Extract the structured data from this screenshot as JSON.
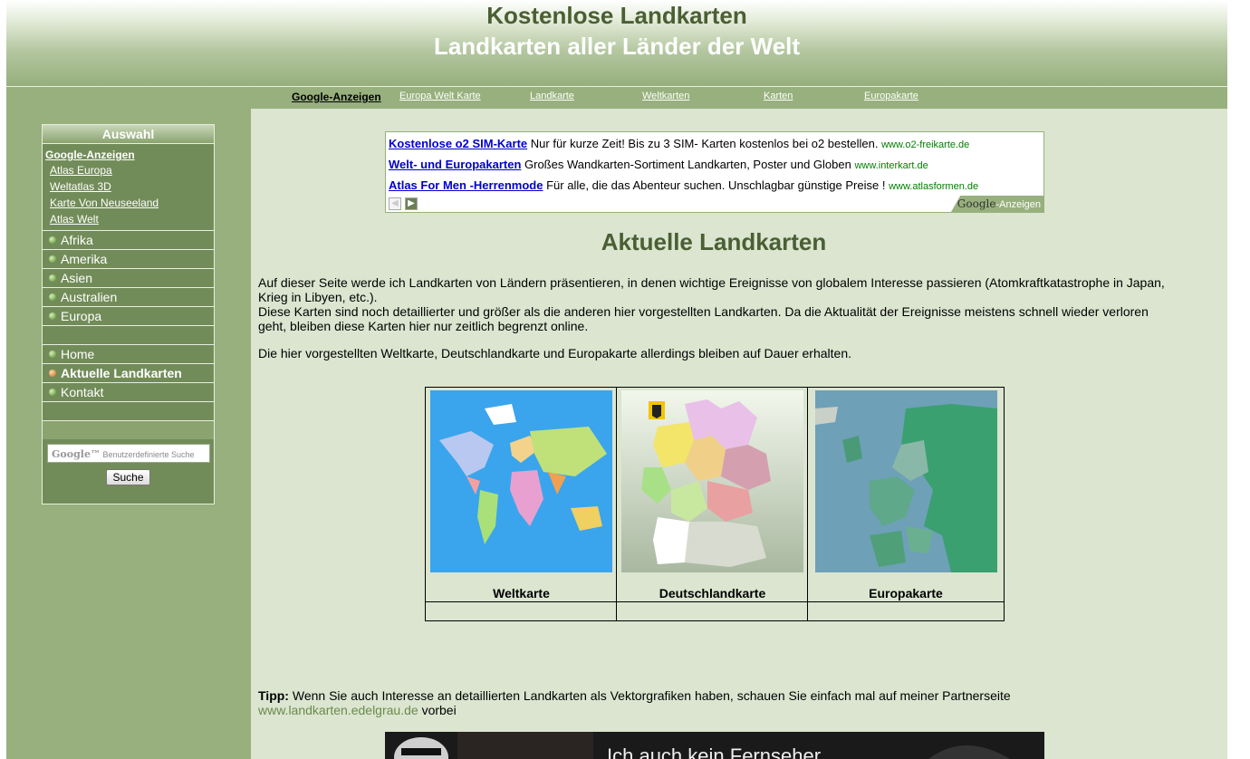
{
  "header": {
    "title_line1": "Kostenlose Landkarten",
    "title_line2": "Landkarten aller Länder der Welt"
  },
  "nav": {
    "items": [
      "Google-Anzeigen",
      "Europa Welt Karte",
      "Landkarte",
      "Weltkarten",
      "Karten",
      "Europakarte"
    ]
  },
  "sidebar": {
    "title": "Auswahl",
    "ads_heading": "Google-Anzeigen",
    "ad_links": [
      "Atlas Europa",
      "Weltatlas 3D",
      "Karte Von Neuseeland",
      "Atlas Welt"
    ],
    "regions": [
      "Afrika",
      "Amerika",
      "Asien",
      "Australien",
      "Europa"
    ],
    "pages": [
      "Home",
      "Aktuelle Landkarten",
      "Kontakt"
    ],
    "active_page": "Aktuelle Landkarten",
    "search_logo": "Google™",
    "search_placeholder": "Benutzerdefinierte Suche",
    "search_button": "Suche"
  },
  "adbox": {
    "ads": [
      {
        "headline": "Kostenlose o2 SIM-Karte",
        "text": "Nur für kurze Zeit! Bis zu 3 SIM- Karten kostenlos bei o2 bestellen.",
        "url": "www.o2-freikarte.de"
      },
      {
        "headline": "Welt- und Europakarten",
        "text": "Großes Wandkarten-Sortiment Landkarten, Poster und Globen",
        "url": "www.interkart.de"
      },
      {
        "headline": "Atlas For Men -Herrenmode",
        "text": "Für alle, die das Abenteur suchen. Unschlagbar günstige Preise !",
        "url": "www.atlasformen.de"
      }
    ],
    "badge_logo": "Google",
    "badge_text": "-Anzeigen"
  },
  "main": {
    "heading": "Aktuelle Landkarten",
    "para1": "Auf dieser Seite werde ich Landkarten von Ländern präsentieren, in denen wichtige Ereignisse von globalem Interesse passieren (Atomkraftkatastrophe in Japan, Krieg in Libyen, etc.).",
    "para2": "Diese Karten sind noch detaillierter und größer als die anderen hier vorgestellten Landkarten. Da die Aktualität der Ereignisse meistens schnell wieder verloren geht, bleiben diese Karten hier nur zeitlich begrenzt online.",
    "para3": "Die hier vorgestellten Weltkarte, Deutschlandkarte und Europakarte allerdings bleiben auf Dauer erhalten.",
    "maps": [
      "Weltkarte",
      "Deutschlandkarte",
      "Europakarte"
    ],
    "tip_label": "Tipp:",
    "tip_text": "Wenn Sie auch Interesse an detaillierten Landkarten als Vektorgrafiken haben, schauen Sie einfach mal auf meiner Partnerseite",
    "tip_link": "www.landkarten.edelgrau.de",
    "tip_end": "vorbei",
    "banner_text": "Ich auch kein Fernseher"
  },
  "colors": {
    "frame_green": "#97b07d",
    "content_bg": "#dbe5d0",
    "sidebar_bg": "#728c59",
    "heading_green": "#4a5f33"
  }
}
